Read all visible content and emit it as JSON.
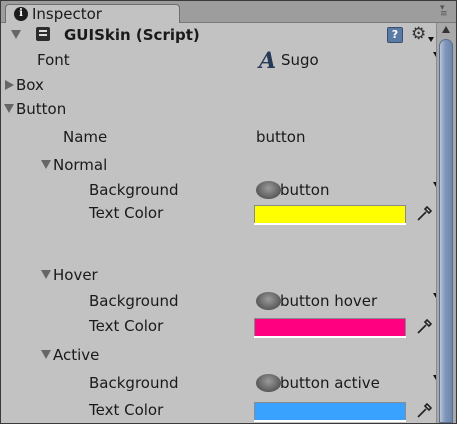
{
  "tab": {
    "icon": "info-icon",
    "label": "Inspector"
  },
  "component": {
    "title": "GUISkin (Script)",
    "script_icon": "script-icon",
    "help_icon": "help-icon",
    "settings_icon": "gear-icon"
  },
  "font": {
    "label": "Font",
    "glyph": "A",
    "value": "Sugo"
  },
  "box": {
    "label": "Box"
  },
  "button": {
    "label": "Button"
  },
  "name": {
    "label": "Name",
    "value": "button"
  },
  "normal": {
    "label": "Normal",
    "background_label": "Background",
    "background_value": "button",
    "text_color_label": "Text Color",
    "color": "#ffff00"
  },
  "hover": {
    "label": "Hover",
    "background_label": "Background",
    "background_value": "button hover",
    "text_color_label": "Text Color",
    "color": "#ff0080"
  },
  "active": {
    "label": "Active",
    "background_label": "Background",
    "background_value": "button active",
    "text_color_label": "Text Color",
    "color": "#39a2ff"
  }
}
